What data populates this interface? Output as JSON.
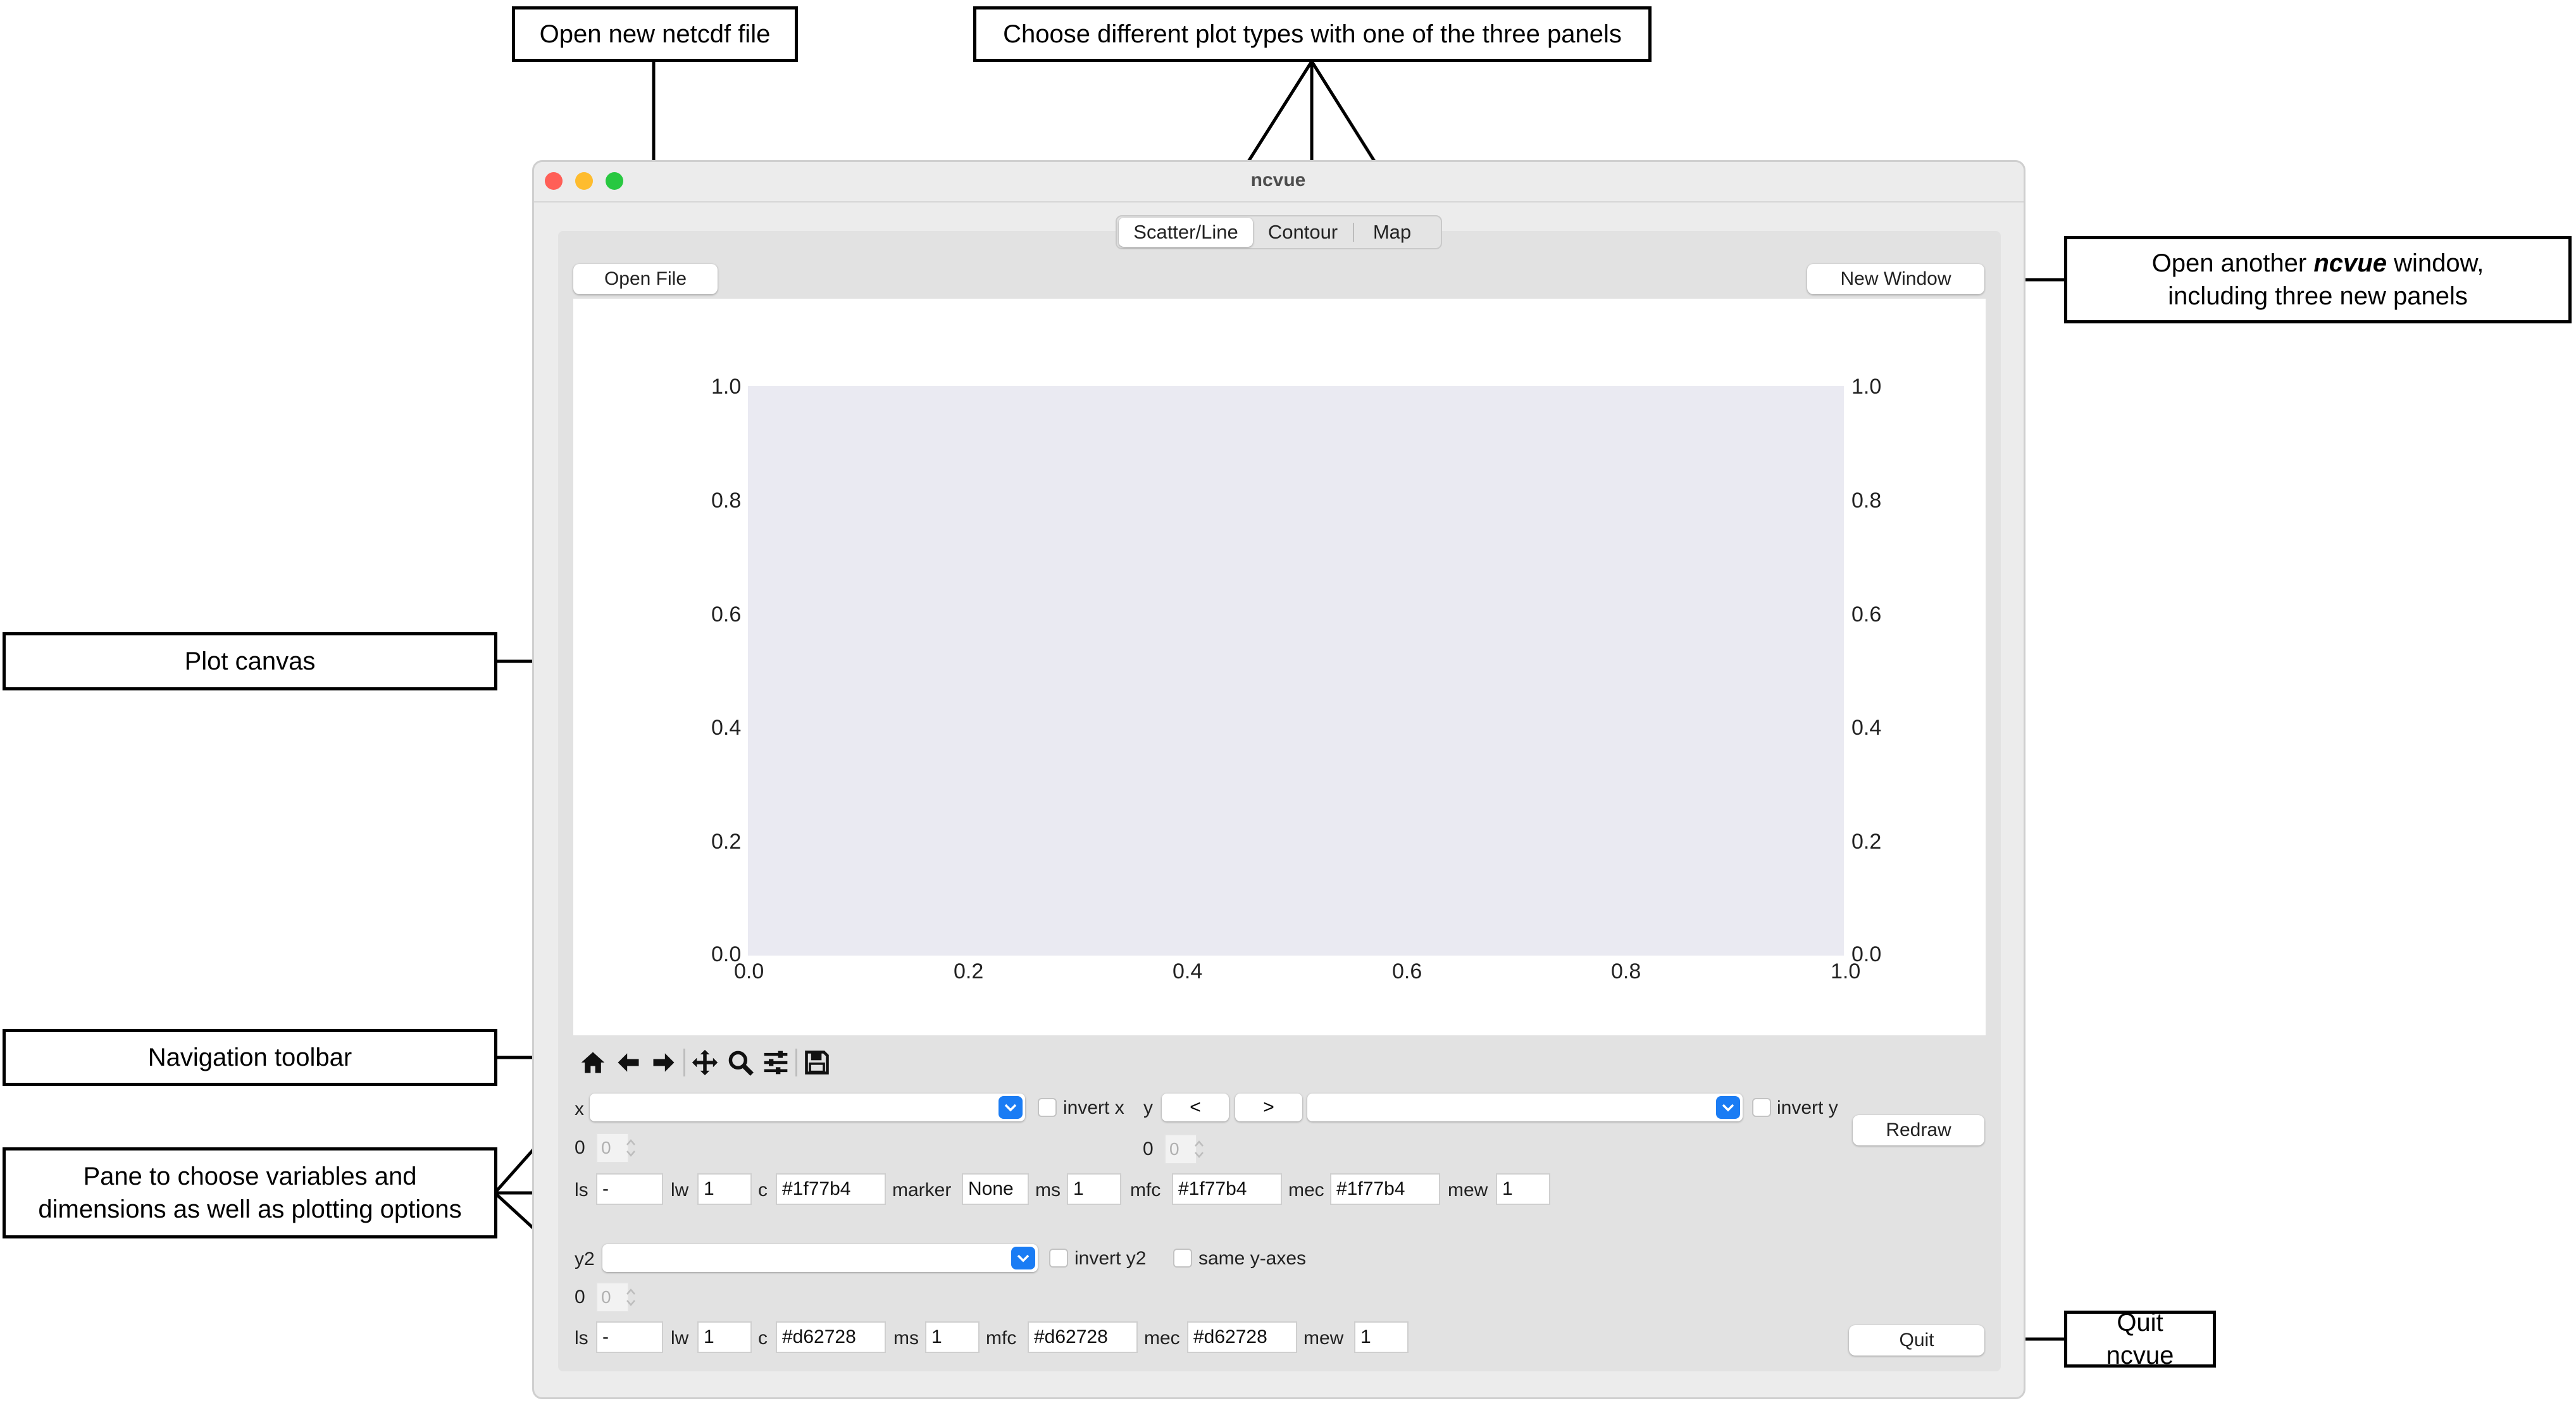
{
  "annotations": {
    "open_file": "Open new netcdf file",
    "plot_types": "Choose different plot types with one of the three panels",
    "new_window_line1": "Open another",
    "new_window_bold": "ncvue",
    "new_window_line1_end": "window,",
    "new_window_line2": "including three new panels",
    "plot_canvas": "Plot canvas",
    "nav_toolbar": "Navigation toolbar",
    "pane_line1": "Pane to choose variables and",
    "pane_line2": "dimensions as well as plotting options",
    "quit": "Quit ncvue"
  },
  "window": {
    "title": "ncvue"
  },
  "tabs": [
    {
      "label": "Scatter/Line",
      "selected": true
    },
    {
      "label": "Contour",
      "selected": false
    },
    {
      "label": "Map",
      "selected": false
    }
  ],
  "buttons": {
    "open_file": "Open File",
    "new_window": "New Window",
    "redraw": "Redraw",
    "quit": "Quit"
  },
  "plot": {
    "y_ticks_left": [
      "1.0",
      "0.8",
      "0.6",
      "0.4",
      "0.2",
      "0.0"
    ],
    "y_ticks_right": [
      "1.0",
      "0.8",
      "0.6",
      "0.4",
      "0.2",
      "0.0"
    ],
    "x_ticks": [
      "0.0",
      "0.2",
      "0.4",
      "0.6",
      "0.8",
      "1.0"
    ],
    "xlim": [
      0,
      1
    ],
    "ylim": [
      0,
      1
    ]
  },
  "toolbar": [
    "home-icon",
    "back-arrow-icon",
    "forward-arrow-icon",
    "pan-icon",
    "zoom-icon",
    "configure-subplots-icon",
    "save-icon"
  ],
  "controls": {
    "x_label": "x",
    "invert_x": "invert x",
    "y_label": "y",
    "prev": "<",
    "next": ">",
    "invert_y": "invert y",
    "x_dim_label": "0",
    "x_dim_value": "0",
    "y_dim_label": "0",
    "y_dim_value": "0",
    "row1": {
      "ls_label": "ls",
      "ls": "-",
      "lw_label": "lw",
      "lw": "1",
      "c_label": "c",
      "c": "#1f77b4",
      "marker_label": "marker",
      "marker": "None",
      "ms_label": "ms",
      "ms": "1",
      "mfc_label": "mfc",
      "mfc": "#1f77b4",
      "mec_label": "mec",
      "mec": "#1f77b4",
      "mew_label": "mew",
      "mew": "1"
    },
    "y2_label": "y2",
    "invert_y2": "invert y2",
    "same_y_axes": "same y-axes",
    "y2_dim_label": "0",
    "y2_dim_value": "0",
    "row2": {
      "ls_label": "ls",
      "ls": "-",
      "lw_label": "lw",
      "lw": "1",
      "c_label": "c",
      "c": "#d62728",
      "ms_label": "ms",
      "ms": "1",
      "mfc_label": "mfc",
      "mfc": "#d62728",
      "mec_label": "mec",
      "mec": "#d62728",
      "mew_label": "mew",
      "mew": "1"
    }
  },
  "colors": {
    "accent": "#1a7cf4",
    "plot_bg": "#eaeaf2",
    "close": "#ff5f57",
    "minimize": "#febc2e",
    "zoom": "#28c840"
  }
}
